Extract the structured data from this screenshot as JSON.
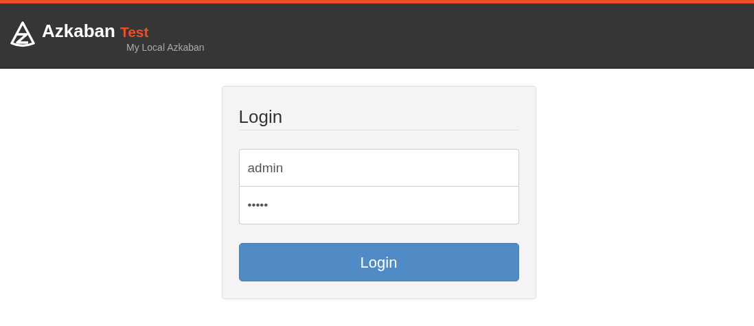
{
  "header": {
    "brand": "Azkaban",
    "environment": "Test",
    "subtitle": "My Local Azkaban"
  },
  "login": {
    "title": "Login",
    "username": {
      "value": "admin"
    },
    "password": {
      "value": "•••••"
    },
    "button": "Login"
  }
}
